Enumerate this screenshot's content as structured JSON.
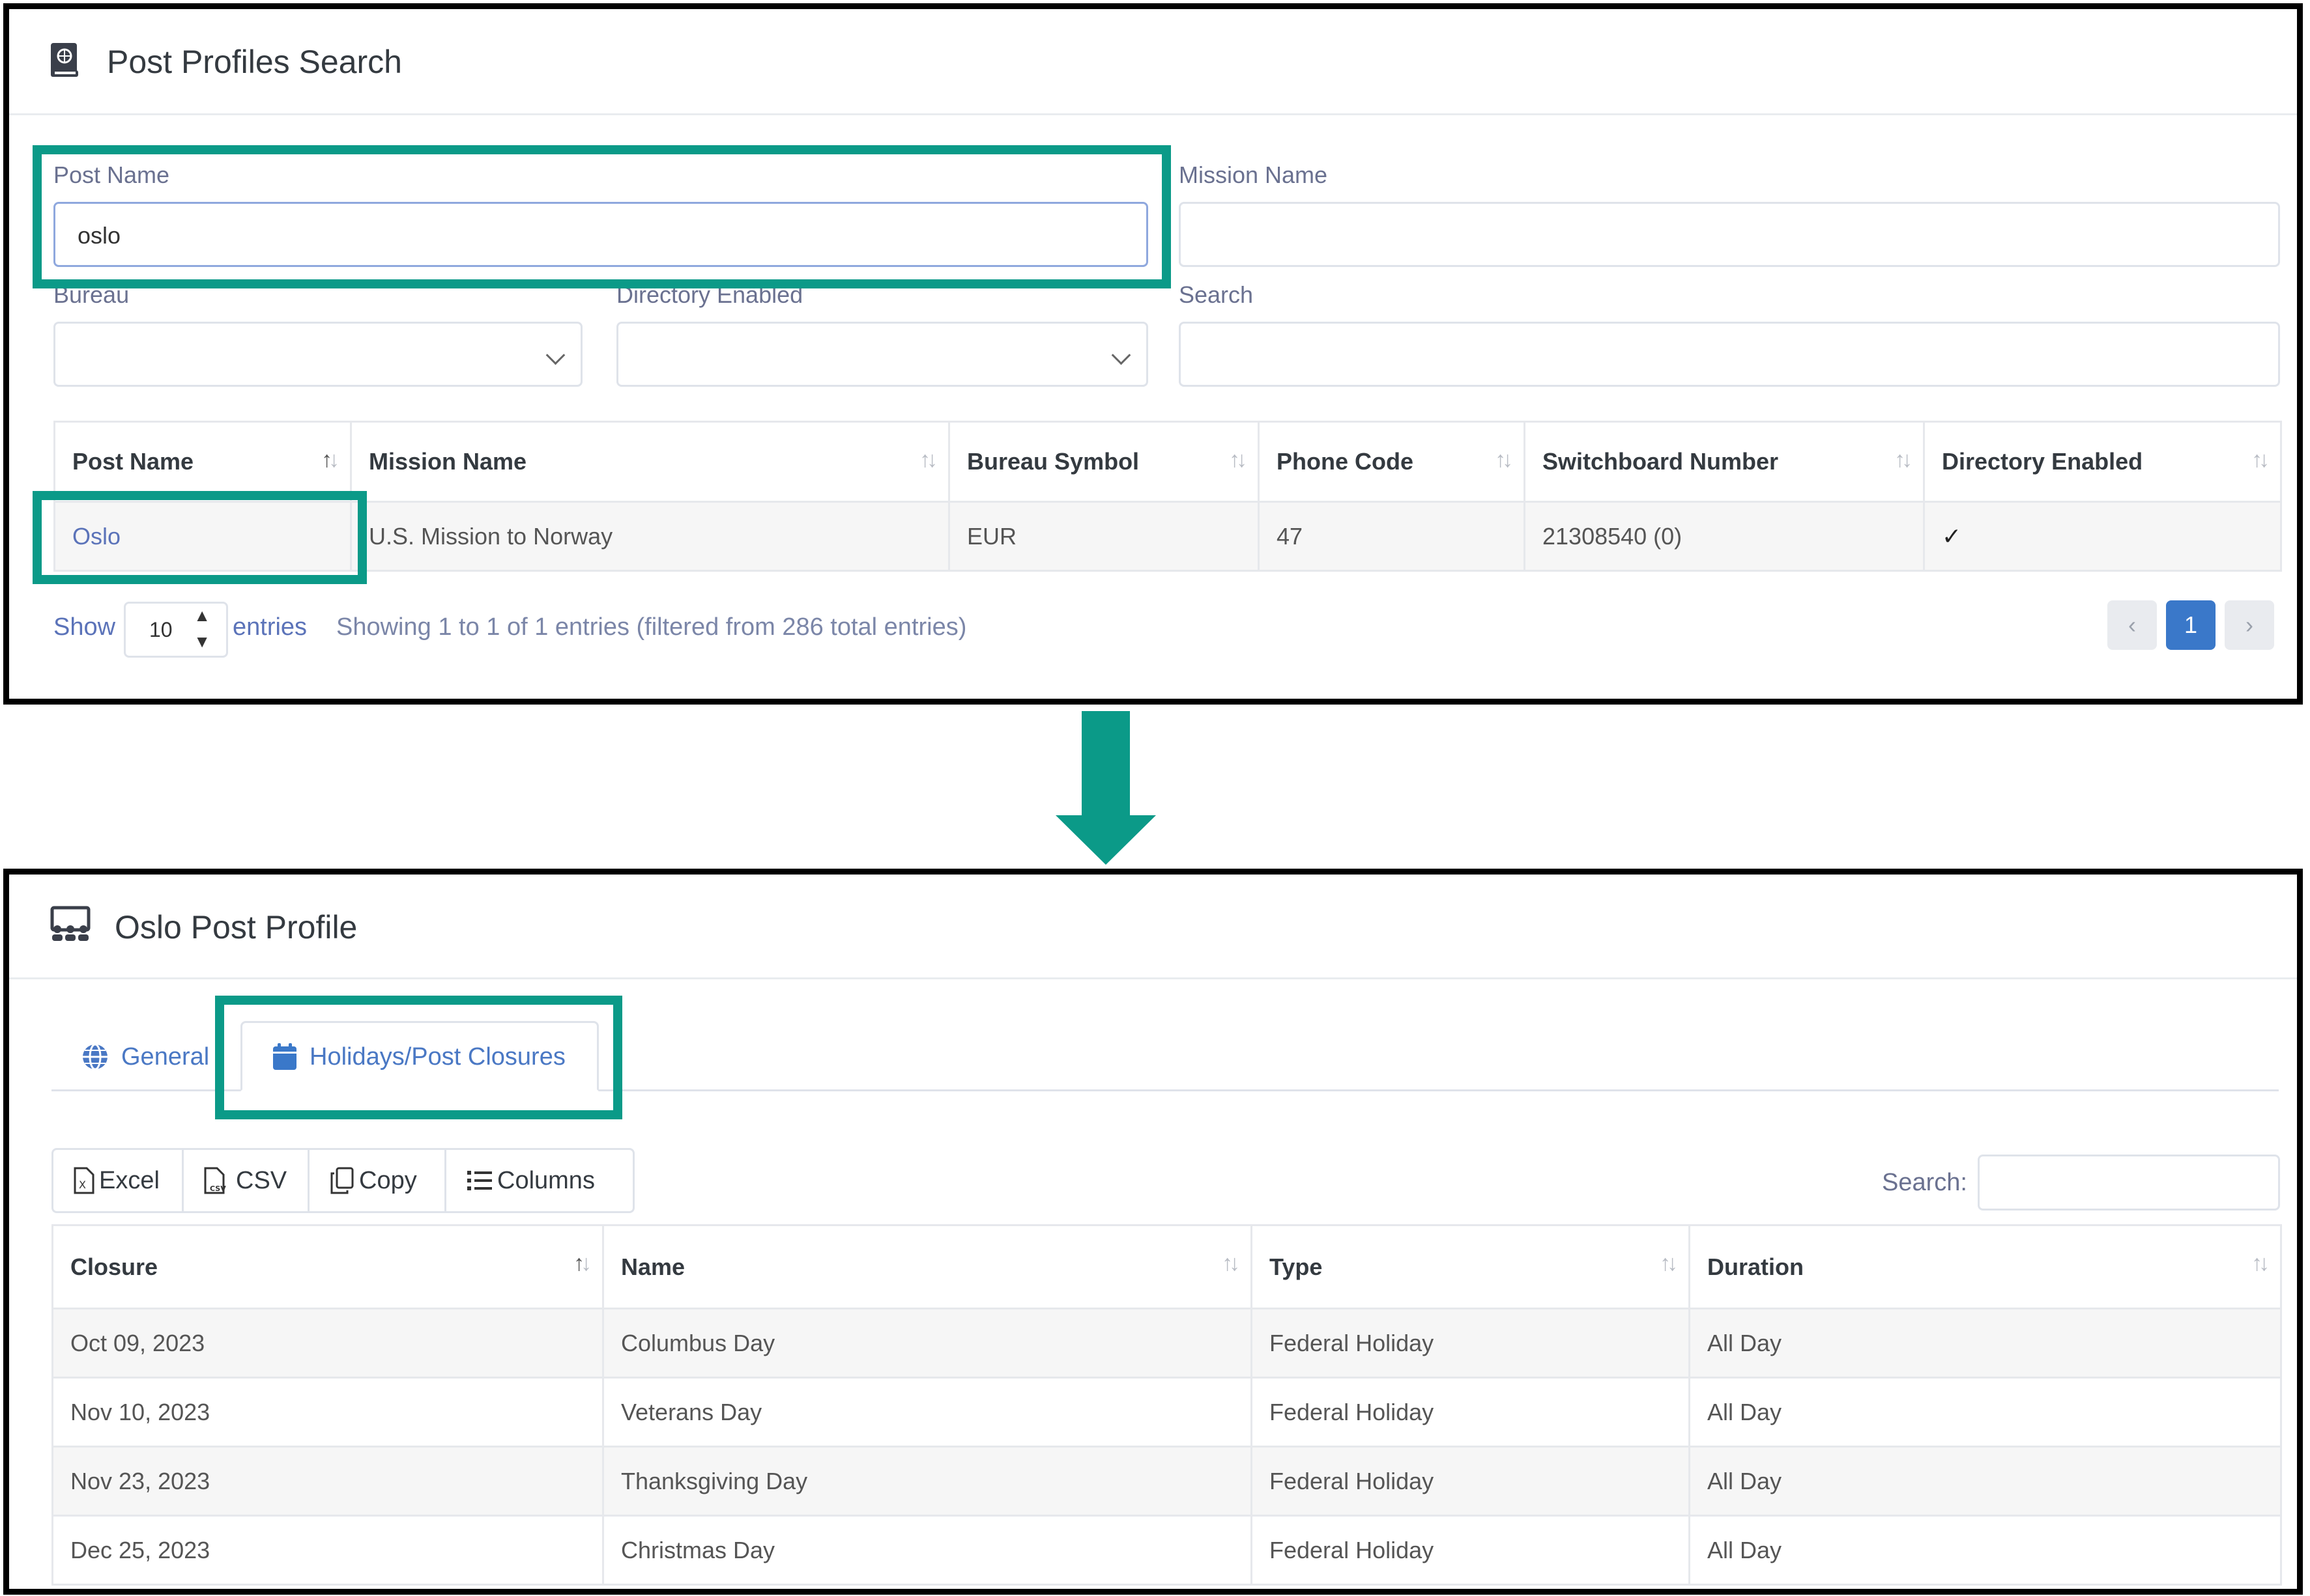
{
  "search_panel": {
    "title": "Post Profiles Search",
    "post_name_label": "Post Name",
    "post_name_value": "oslo",
    "mission_name_label": "Mission Name",
    "mission_name_value": "",
    "bureau_label": "Bureau",
    "bureau_value": "",
    "directory_enabled_label": "Directory Enabled",
    "directory_enabled_value": "",
    "search_label": "Search",
    "search_value": "",
    "table": {
      "headers": [
        "Post Name",
        "Mission Name",
        "Bureau Symbol",
        "Phone Code",
        "Switchboard Number",
        "Directory Enabled"
      ],
      "rows": [
        {
          "post_name": "Oslo",
          "mission_name": "U.S. Mission to Norway",
          "bureau_symbol": "EUR",
          "phone_code": "47",
          "switchboard": "21308540 (0)",
          "directory_enabled": "✓"
        }
      ]
    },
    "show_label": "Show",
    "entries_value": "10",
    "entries_label": "entries",
    "info_text": "Showing 1 to 1 of 1 entries (filtered from 286 total entries)",
    "pager": {
      "prev": "‹",
      "current": "1",
      "next": "›"
    }
  },
  "profile_panel": {
    "title": "Oslo Post Profile",
    "tabs": [
      {
        "label": "General",
        "icon": "globe-icon"
      },
      {
        "label": "Holidays/Post Closures",
        "icon": "calendar-icon"
      }
    ],
    "buttons": {
      "excel": "Excel",
      "csv": "CSV",
      "copy": "Copy",
      "columns": "Columns"
    },
    "search_label": "Search:",
    "search_value": "",
    "table": {
      "headers": [
        "Closure",
        "Name",
        "Type",
        "Duration"
      ],
      "rows": [
        {
          "closure": "Oct 09, 2023",
          "name": "Columbus Day",
          "type": "Federal Holiday",
          "duration": "All Day"
        },
        {
          "closure": "Nov 10, 2023",
          "name": "Veterans Day",
          "type": "Federal Holiday",
          "duration": "All Day"
        },
        {
          "closure": "Nov 23, 2023",
          "name": "Thanksgiving Day",
          "type": "Federal Holiday",
          "duration": "All Day"
        },
        {
          "closure": "Dec 25, 2023",
          "name": "Christmas Day",
          "type": "Federal Holiday",
          "duration": "All Day"
        }
      ]
    }
  },
  "colors": {
    "highlight": "#0b9a88",
    "link": "#5b73b9",
    "accent": "#3a78c9"
  }
}
